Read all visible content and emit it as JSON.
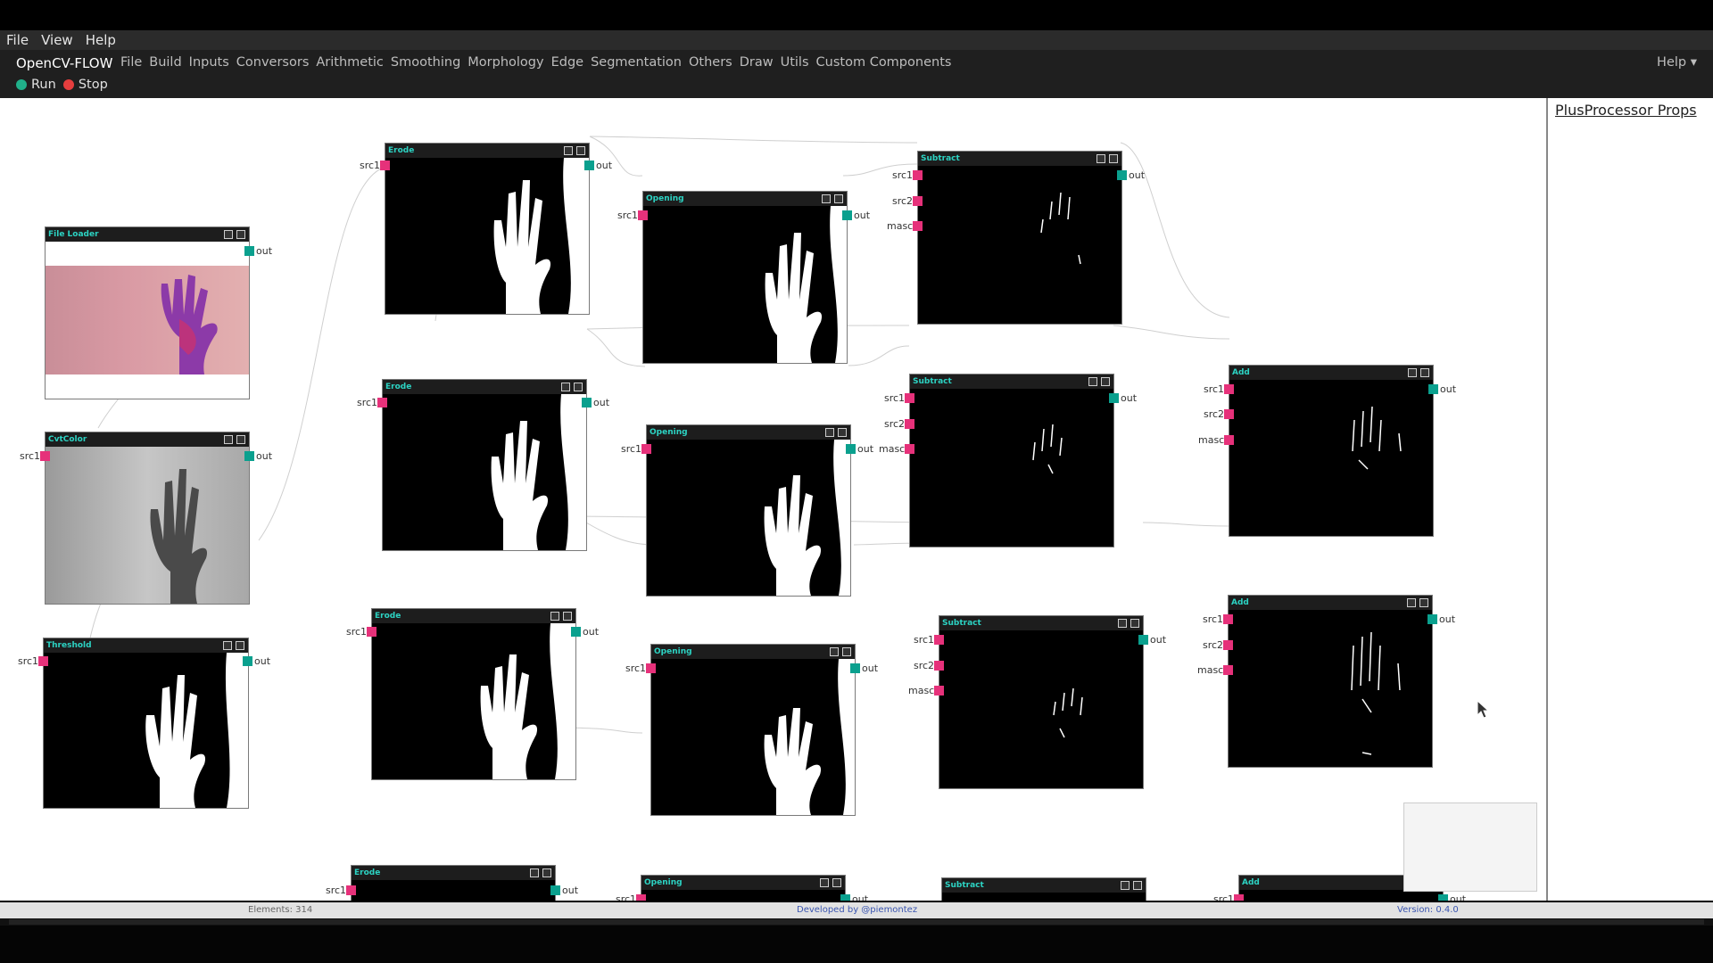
{
  "menubar": {
    "items": [
      "File",
      "View",
      "Help"
    ]
  },
  "app": {
    "brand": "OpenCV-FLOW",
    "menu": [
      "File",
      "Build",
      "Inputs",
      "Conversors",
      "Arithmetic",
      "Smoothing",
      "Morphology",
      "Edge",
      "Segmentation",
      "Others",
      "Draw",
      "Utils",
      "Custom Components"
    ],
    "help": "Help ▾",
    "run": "Run",
    "stop": "Stop"
  },
  "side": {
    "title": "PlusProcessor Props"
  },
  "status": {
    "elements": "Elements: 314",
    "developer": "Developed by @piemontez",
    "version": "Version: 0.4.0"
  },
  "nodes": [
    {
      "title": "File Loader",
      "out": "out"
    },
    {
      "title": "CvtColor",
      "in": [
        "src1"
      ],
      "out": "out"
    },
    {
      "title": "Threshold",
      "in": [
        "src1"
      ],
      "out": "out"
    },
    {
      "title": "Erode",
      "in": [
        "src1"
      ],
      "out": "out"
    },
    {
      "title": "Erode",
      "in": [
        "src1"
      ],
      "out": "out"
    },
    {
      "title": "Erode",
      "in": [
        "src1"
      ],
      "out": "out"
    },
    {
      "title": "Erode",
      "in": [
        "src1"
      ],
      "out": "out"
    },
    {
      "title": "Opening",
      "in": [
        "src1"
      ],
      "out": "out"
    },
    {
      "title": "Opening",
      "in": [
        "src1"
      ],
      "out": "out"
    },
    {
      "title": "Opening",
      "in": [
        "src1"
      ],
      "out": "out"
    },
    {
      "title": "Opening",
      "in": [
        "src1"
      ],
      "out": "out"
    },
    {
      "title": "Subtract",
      "in": [
        "src1",
        "src2",
        "masc"
      ],
      "out": "out"
    },
    {
      "title": "Subtract",
      "in": [
        "src1",
        "src2",
        "masc"
      ],
      "out": "out"
    },
    {
      "title": "Subtract",
      "in": [
        "src1",
        "src2",
        "masc"
      ],
      "out": "out"
    },
    {
      "title": "Subtract",
      "in": [],
      "out": ""
    },
    {
      "title": "Add",
      "in": [
        "src1",
        "src2",
        "masc"
      ],
      "out": "out"
    },
    {
      "title": "Add",
      "in": [
        "src1",
        "src2",
        "masc"
      ],
      "out": "out"
    },
    {
      "title": "Add",
      "in": [
        "src1"
      ],
      "out": "out"
    }
  ],
  "colors": {
    "input_port": "#e6317a",
    "output_port": "#0aa08e",
    "header_text": "#2cd3c3"
  }
}
